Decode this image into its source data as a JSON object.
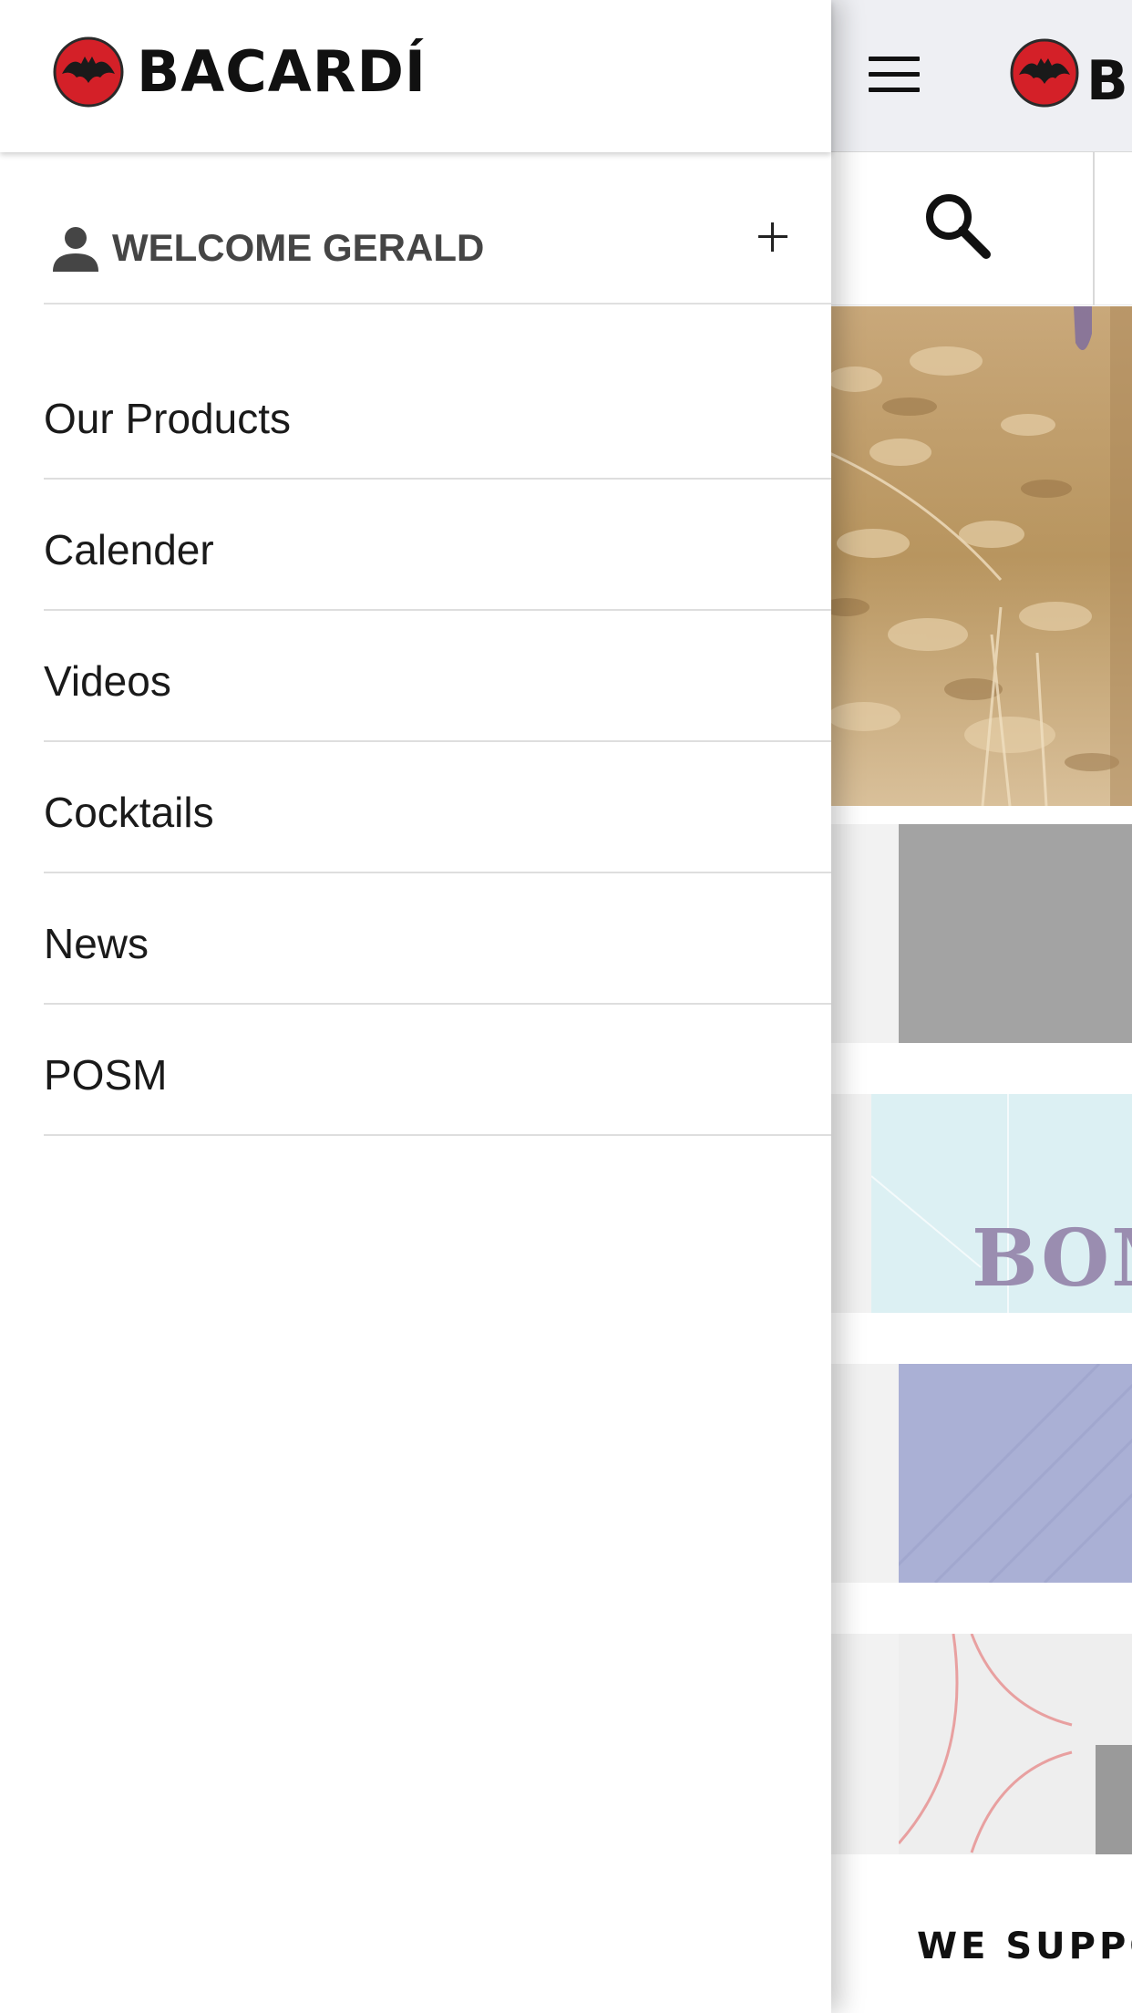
{
  "brand": {
    "name": "BACARDÍ",
    "colors": {
      "logo_red": "#d42028",
      "logo_black": "#111111"
    }
  },
  "drawer": {
    "welcome": {
      "icon": "person-icon",
      "text": "WELCOME GERALD",
      "expand_icon": "plus-icon"
    },
    "menu_items": [
      {
        "label": "Our Products"
      },
      {
        "label": "Calender"
      },
      {
        "label": "Videos"
      },
      {
        "label": "Cocktails"
      },
      {
        "label": "News"
      },
      {
        "label": "POSM"
      }
    ]
  },
  "main": {
    "header": {
      "menu_icon": "hamburger-icon",
      "brand_text": "B"
    },
    "search": {
      "icon": "search-icon"
    },
    "tiles": [
      {
        "text": ""
      },
      {
        "text": "BOM"
      },
      {
        "text": ""
      },
      {
        "text": ""
      }
    ],
    "section_title": "WE SUPPO"
  }
}
